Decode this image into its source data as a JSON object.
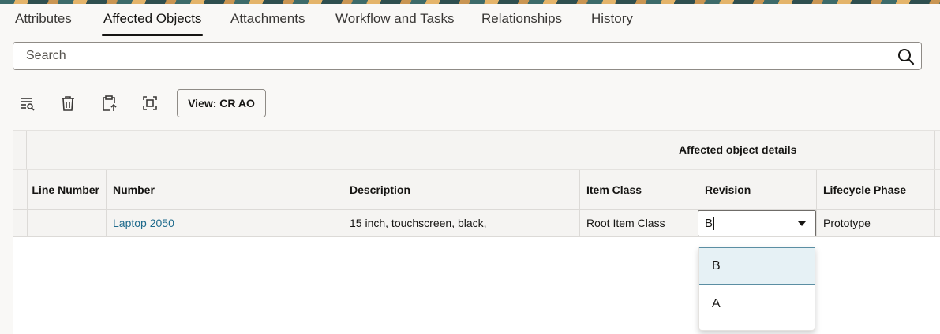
{
  "tabs": [
    {
      "label": "Attributes"
    },
    {
      "label": "Affected Objects",
      "active": true
    },
    {
      "label": "Attachments"
    },
    {
      "label": "Workflow and Tasks"
    },
    {
      "label": "Relationships"
    },
    {
      "label": "History"
    }
  ],
  "search": {
    "placeholder": "Search",
    "icon": "search-icon"
  },
  "toolbar": {
    "icons": [
      "filter-list-icon",
      "delete-icon",
      "clipboard-upload-icon",
      "fit-screen-icon"
    ],
    "view_label": "View: CR AO"
  },
  "grid": {
    "group_title": "Affected object details",
    "columns": [
      "Line Number",
      "Number",
      "Description",
      "Item Class",
      "Revision",
      "Lifecycle Phase"
    ],
    "rows": [
      {
        "line_number": "",
        "number": "Laptop 2050",
        "description": "15 inch, touchscreen, black,",
        "item_class": "Root Item Class",
        "revision": "B",
        "lifecycle_phase": "Prototype"
      }
    ]
  },
  "revision_dropdown": {
    "options": [
      "B",
      "A"
    ],
    "highlighted": "B"
  },
  "colors": {
    "link": "#1e6a8c",
    "highlight": "#e6f1f5",
    "background": "#f9f8f6"
  }
}
